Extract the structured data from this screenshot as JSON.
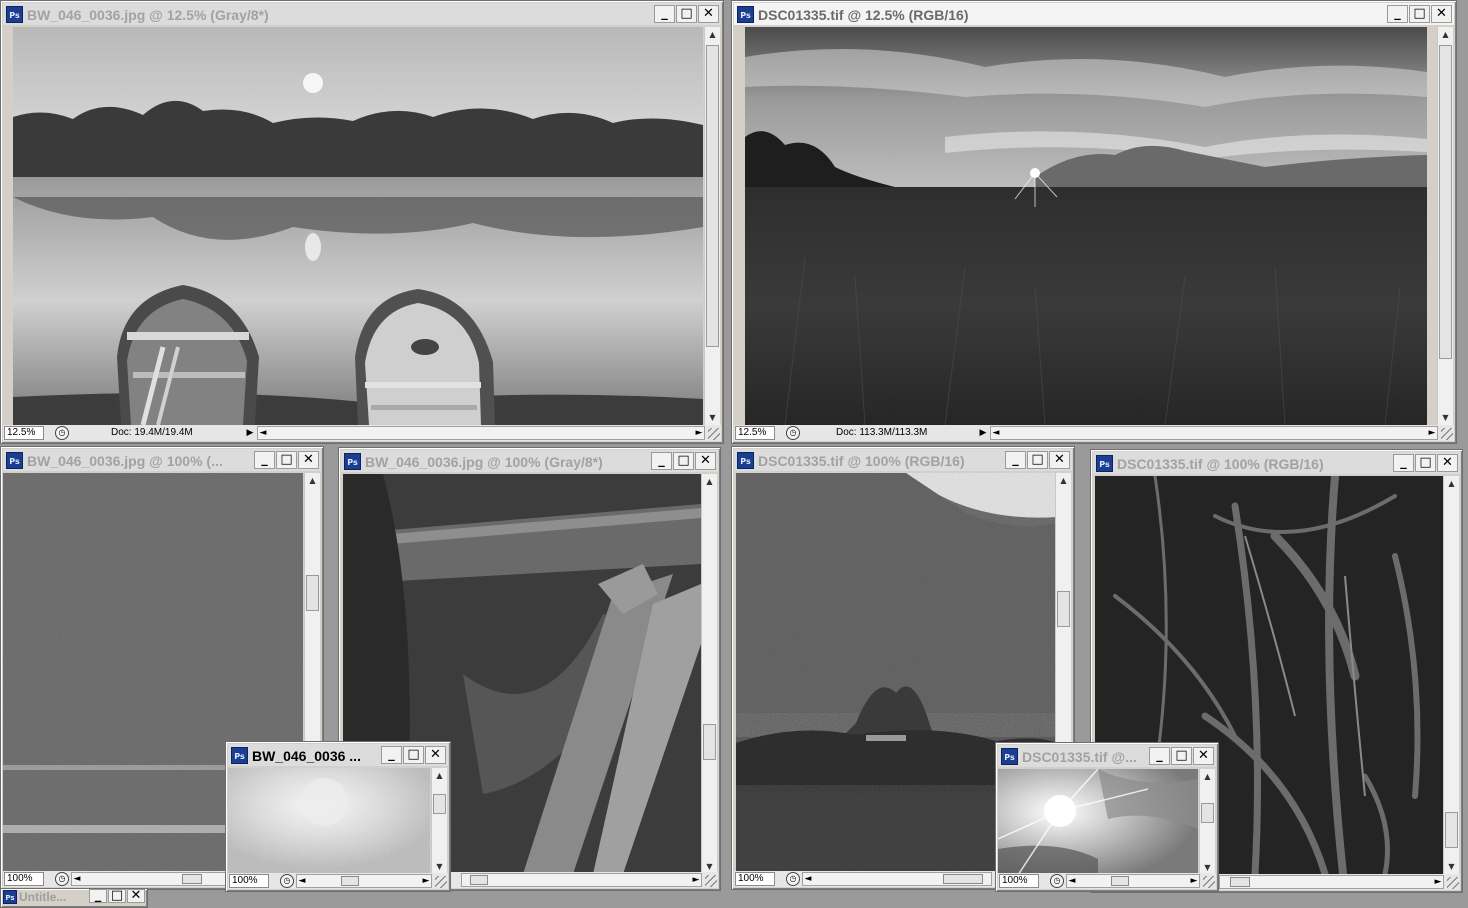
{
  "window_buttons": {
    "minimize": "_",
    "maximize": "□",
    "close": "✕"
  },
  "icons": {
    "app_icon": "photoshop-doc-icon",
    "status": "status-info-icon",
    "menu_arrow": "▶",
    "scroll_up": "▲",
    "scroll_down": "▼",
    "scroll_left": "◄",
    "scroll_right": "►"
  },
  "app_badge": "Ps",
  "colors": {
    "workspace": "#9a9a9a",
    "window_chrome": "#d4d0c8",
    "doc_icon": "#1b3f8e"
  },
  "windows": [
    {
      "title": "BW_046_0036.jpg @ 12.5% (Gray/8*)",
      "zoom": "12.5%",
      "doc_info": "Doc: 19.4M/19.4M",
      "state": "inactive",
      "image": "lake-with-two-rowboats"
    },
    {
      "title": "DSC01335.tif @ 12.5% (RGB/16)",
      "zoom": "12.5%",
      "doc_info": "Doc: 113.3M/113.3M",
      "state": "active",
      "image": "meadow-sunset-mountains"
    },
    {
      "title": "BW_046_0036.jpg @ 100% (...",
      "zoom": "100%",
      "state": "inactive",
      "image": "water-grain-closeup"
    },
    {
      "title": "BW_046_0036.jpg @ 100% (Gray/8*)",
      "zoom": "",
      "state": "inactive",
      "image": "boat-wood-closeup"
    },
    {
      "title": "DSC01335.tif @ 100% (RGB/16)",
      "zoom": "100%",
      "state": "inactive",
      "image": "mountain-trees-closeup"
    },
    {
      "title": "DSC01335.tif @ 100% (RGB/16)",
      "zoom": "",
      "state": "inactive",
      "image": "reeds-closeup"
    },
    {
      "title": "BW_046_0036 ...",
      "zoom": "100%",
      "state": "focus",
      "image": "sun-glow-closeup"
    },
    {
      "title": "DSC01335.tif @...",
      "zoom": "100%",
      "state": "inactive",
      "image": "sunburst-closeup"
    }
  ],
  "minimized": {
    "title": "Untitle..."
  }
}
